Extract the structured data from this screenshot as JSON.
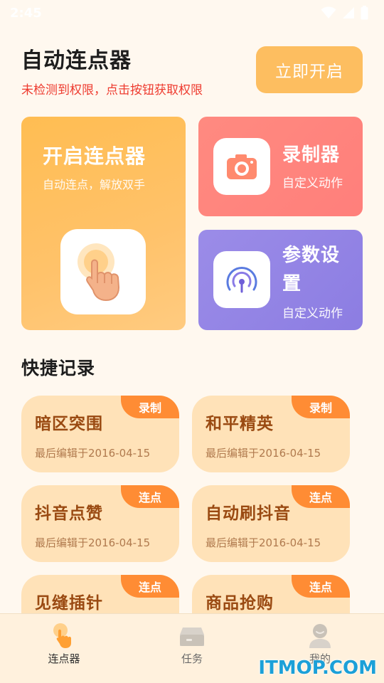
{
  "status_bar": {
    "time": "2:45"
  },
  "header": {
    "title": "自动连点器",
    "warning": "未检测到权限，点击按钮获取权限",
    "open_button": "立即开启"
  },
  "cards": {
    "main": {
      "title": "开启连点器",
      "subtitle": "自动连点，解放双手"
    },
    "recorder": {
      "title": "录制器",
      "subtitle": "自定义动作"
    },
    "settings": {
      "title_line1": "参数设",
      "title_line2": "置",
      "subtitle": "自定义动作"
    }
  },
  "quick_records": {
    "title": "快捷记录",
    "items": [
      {
        "title": "暗区突围",
        "tag": "录制",
        "date": "最后编辑于2016-04-15"
      },
      {
        "title": "和平精英",
        "tag": "录制",
        "date": "最后编辑于2016-04-15"
      },
      {
        "title": "抖音点赞",
        "tag": "连点",
        "date": "最后编辑于2016-04-15"
      },
      {
        "title": "自动刷抖音",
        "tag": "连点",
        "date": "最后编辑于2016-04-15"
      },
      {
        "title": "见缝插针",
        "tag": "连点",
        "date": ""
      },
      {
        "title": "商品抢购",
        "tag": "连点",
        "date": ""
      }
    ]
  },
  "tab_bar": {
    "tabs": [
      {
        "label": "连点器",
        "icon": "finger-tap-icon",
        "active": true
      },
      {
        "label": "任务",
        "icon": "task-box-icon",
        "active": false
      },
      {
        "label": "我的",
        "icon": "profile-icon",
        "active": false
      }
    ]
  },
  "watermark": "ITMOP.COM",
  "colors": {
    "accent_orange": "#FDBE60",
    "warning_red": "#EE3B2F",
    "recorder_card": "#FF8A80",
    "settings_card": "#9B8CE8",
    "record_card_bg": "#FFE2B8",
    "tag_orange": "#FF8C34"
  }
}
